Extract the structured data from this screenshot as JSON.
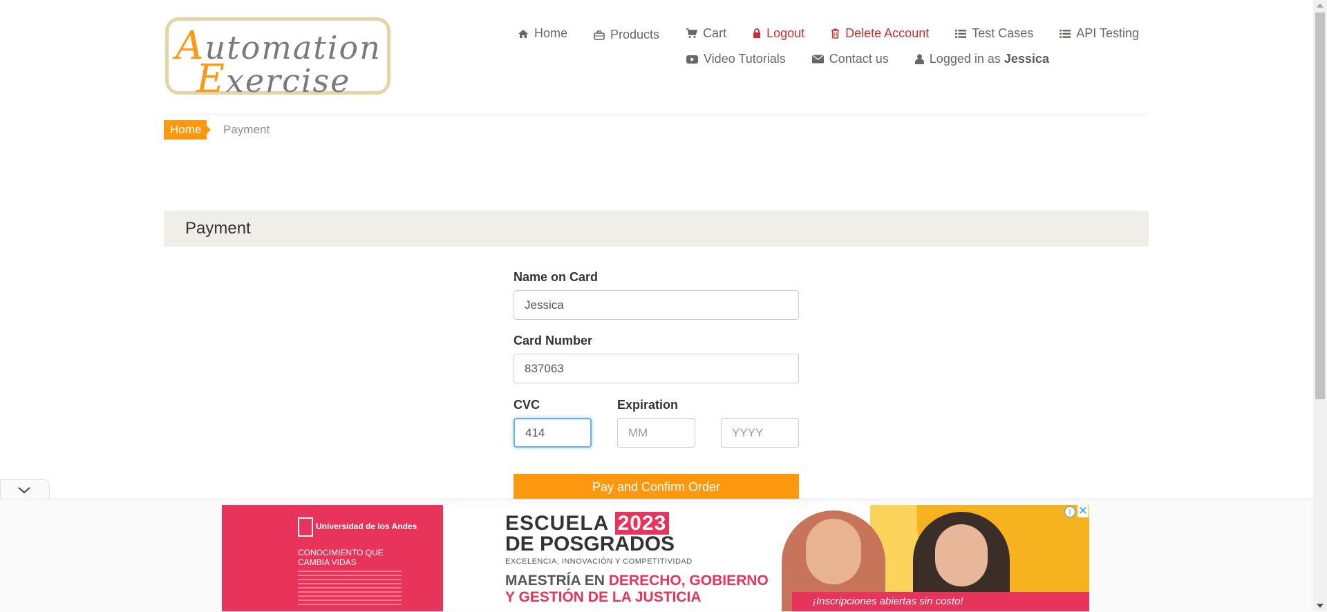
{
  "logo": {
    "line1_cap": "A",
    "line1_rest": "utomation",
    "line2_cap": "E",
    "line2_rest": "xercise"
  },
  "nav": {
    "row1": [
      {
        "label": "Home",
        "icon": "home-icon"
      },
      {
        "label": "Products",
        "icon": "briefcase-icon"
      },
      {
        "label": "Cart",
        "icon": "cart-icon"
      },
      {
        "label": "Logout",
        "icon": "lock-icon"
      },
      {
        "label": "Delete Account",
        "icon": "trash-icon"
      },
      {
        "label": "Test Cases",
        "icon": "list-icon"
      },
      {
        "label": "API Testing",
        "icon": "list-icon"
      }
    ],
    "row2": [
      {
        "label": "Video Tutorials",
        "icon": "youtube-icon"
      },
      {
        "label": "Contact us",
        "icon": "envelope-icon"
      },
      {
        "label": "Logged in as",
        "user": "Jessica",
        "icon": "user-icon"
      }
    ]
  },
  "breadcrumb": {
    "home": "Home",
    "current": "Payment"
  },
  "panel": {
    "title": "Payment"
  },
  "form": {
    "name_label": "Name on Card",
    "name_value": "Jessica",
    "card_label": "Card Number",
    "card_value": "837063",
    "cvc_label": "CVC",
    "cvc_value": "414",
    "expiration_label": "Expiration",
    "month_placeholder": "MM",
    "year_placeholder": "YYYY",
    "submit_label": "Pay and Confirm Order"
  },
  "ad": {
    "university": "Universidad de los Andes",
    "tagline": "CONOCIMIENTO QUE CAMBIA VIDAS",
    "headline1": "ESCUELA",
    "year": "2023",
    "headline2": "DE POSGRADOS",
    "subline": "EXCELENCIA, INNOVACIÓN Y COMPETITIVIDAD",
    "program1": "MAESTRÍA EN",
    "program1_highlight": "DERECHO, GOBIERNO",
    "program2": "Y GESTIÓN DE LA JUSTICIA",
    "banner": "¡Inscripciones abiertas sin costo!",
    "info_glyph": "i",
    "close_glyph": "✕"
  },
  "colors": {
    "accent": "#fe980f",
    "danger": "#c52f2f",
    "panel": "#efeee8",
    "ad_pink": "#e8335a"
  }
}
